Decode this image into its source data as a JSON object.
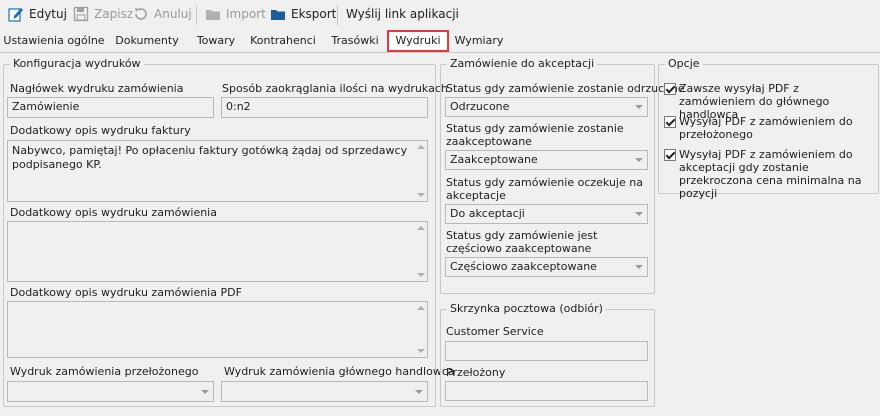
{
  "toolbar": {
    "edit": "Edytuj",
    "save": "Zapisz",
    "cancel": "Anuluj",
    "import": "Import",
    "export": "Eksport",
    "send_link": "Wyślij link aplikacji"
  },
  "tabs": [
    {
      "label": "Ustawienia ogólne"
    },
    {
      "label": "Dokumenty"
    },
    {
      "label": "Towary"
    },
    {
      "label": "Kontrahenci"
    },
    {
      "label": "Trasówki"
    },
    {
      "label": "Wydruki",
      "active": true
    },
    {
      "label": "Wymiary"
    }
  ],
  "config": {
    "title": "Konfiguracja wydruków",
    "header_label": "Nagłówek wydruku zamówienia",
    "header_value": "Zamówienie",
    "rounding_label": "Sposób zaokrąglania ilości na wydrukach",
    "rounding_value": "0:n2",
    "invoice_desc_label": "Dodatkowy opis wydruku faktury",
    "invoice_desc_line1": "Nabywco, pamiętaj! Po opłaceniu faktury gotówką żądaj od sprzedawcy",
    "invoice_desc_line2": "podpisanego KP.",
    "order_desc_label": "Dodatkowy opis wydruku zamówienia",
    "order_desc_value": "",
    "pdf_desc_label": "Dodatkowy opis wydruku zamówienia PDF",
    "pdf_desc_value": "",
    "supervisor_print_label": "Wydruk zamówienia przełożonego",
    "supervisor_print_value": "",
    "main_buyer_print_label": "Wydruk zamówienia głównego handlowca",
    "main_buyer_print_value": ""
  },
  "approval": {
    "title": "Zamówienie do akceptacji",
    "rejected_label": "Status gdy zamówienie zostanie odrzucone",
    "rejected_value": "Odrzucone",
    "accepted_label": "Status gdy zamówienie zostanie zaakceptowane",
    "accepted_value": "Zaakceptowane",
    "pending_label": "Status gdy zamówienie oczekuje na akceptacje",
    "pending_value": "Do akceptacji",
    "partial_label": "Status gdy zamówienie jest częściowo zaakceptowane",
    "partial_value": "Częściowo zaakceptowane"
  },
  "mailbox": {
    "title": "Skrzynka pocztowa (odbiór)",
    "customer_service_label": "Customer Service",
    "customer_service_value": "",
    "supervisor_label": "Przełożony",
    "supervisor_value": ""
  },
  "options": {
    "title": "Opcje",
    "items": [
      {
        "label": "Zawsze wysyłaj PDF z zamówieniem do głównego handlowca",
        "checked": true
      },
      {
        "label": "Wysyłaj PDF z zamówieniem do przełożonego",
        "checked": true
      },
      {
        "label": "Wysyłaj PDF z zamówieniem do akceptacji gdy zostanie przekroczona cena minimalna na pozycji",
        "checked": true
      }
    ]
  }
}
